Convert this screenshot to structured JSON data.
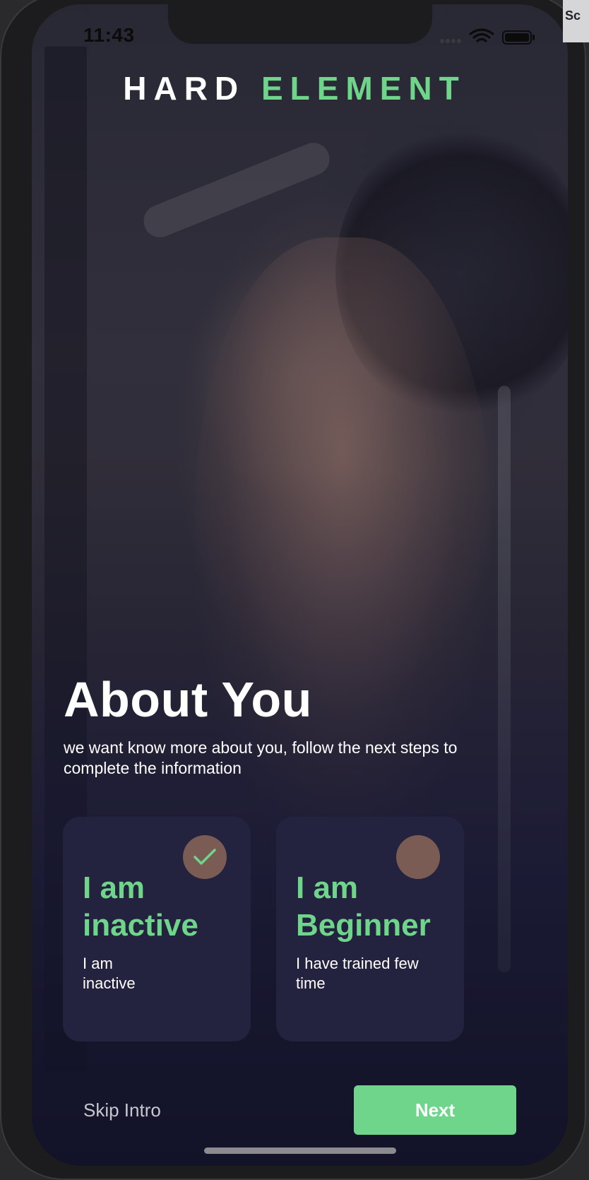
{
  "status_bar": {
    "time": "11:43",
    "icons": [
      "signal-dots-icon",
      "wifi-icon",
      "battery-icon"
    ]
  },
  "brand": {
    "part1": "HARD",
    "part2": "ELEMENT",
    "accent_color": "#6fd58a"
  },
  "page": {
    "title": "About You",
    "subtitle": "we want know more about you, follow the next steps to complete the information"
  },
  "cards": [
    {
      "title": "I am inactive",
      "description": "I am inactive",
      "selected": true,
      "icon": "check-icon"
    },
    {
      "title": "I am Beginner",
      "description": "I have trained few time",
      "selected": false,
      "icon": ""
    }
  ],
  "actions": {
    "skip_label": "Skip Intro",
    "next_label": "Next"
  },
  "edge_text": "Sc"
}
